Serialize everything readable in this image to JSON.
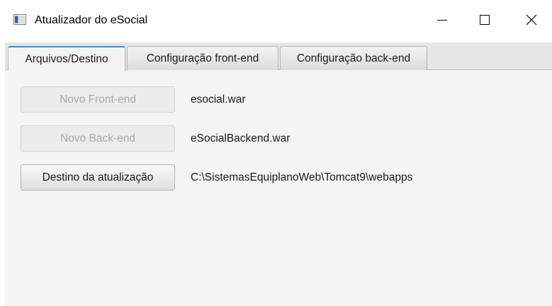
{
  "window": {
    "title": "Atualizador do eSocial",
    "icon": "app-window-icon",
    "controls": {
      "minimize_icon": "minimize-icon",
      "maximize_icon": "maximize-icon",
      "close_icon": "close-icon"
    }
  },
  "tabs": [
    {
      "label": "Arquivos/Destino",
      "active": true
    },
    {
      "label": "Configuração front-end",
      "active": false
    },
    {
      "label": "Configuração back-end",
      "active": false
    }
  ],
  "files": {
    "front_button": "Novo Front-end",
    "front_value": "esocial.war",
    "back_button": "Novo Back-end",
    "back_value": "eSocialBackend.war",
    "dest_button": "Destino da atualização",
    "dest_value": "C:\\SistemasEquiplanoWeb\\Tomcat9\\webapps"
  },
  "colors": {
    "active_tab_accent": "#3c8fd0",
    "disabled_text": "#a8a8a8",
    "content_bg": "#f4f4f4"
  }
}
